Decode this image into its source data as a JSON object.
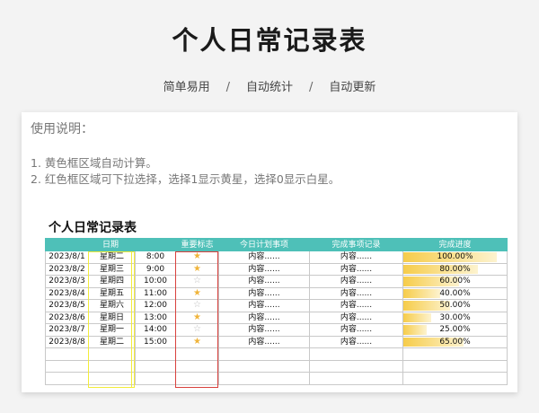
{
  "header": {
    "title": "个人日常记录表",
    "subtitle": [
      "简单易用",
      "自动统计",
      "自动更新"
    ],
    "separator": "/"
  },
  "instructions": {
    "title": "使用说明：",
    "lines": [
      "1. 黄色框区域自动计算。",
      "2. 红色框区域可下拉选择，选择1显示黄星，选择0显示白星。"
    ]
  },
  "sheet": {
    "title": "个人日常记录表",
    "columns": [
      "日期",
      "重要标志",
      "今日计划事项",
      "完成事项记录",
      "完成进度"
    ],
    "rows": [
      {
        "date": "2023/8/1",
        "weekday": "星期二",
        "time": "8:00",
        "star": "filled",
        "plan": "内容......",
        "done": "内容......",
        "progress": 1.0,
        "progress_label": "100.00%"
      },
      {
        "date": "2023/8/2",
        "weekday": "星期三",
        "time": "9:00",
        "star": "filled",
        "plan": "内容......",
        "done": "内容......",
        "progress": 0.8,
        "progress_label": "80.00%"
      },
      {
        "date": "2023/8/3",
        "weekday": "星期四",
        "time": "10:00",
        "star": "empty",
        "plan": "内容......",
        "done": "内容......",
        "progress": 0.6,
        "progress_label": "60.00%"
      },
      {
        "date": "2023/8/4",
        "weekday": "星期五",
        "time": "11:00",
        "star": "filled",
        "plan": "内容......",
        "done": "内容......",
        "progress": 0.4,
        "progress_label": "40.00%"
      },
      {
        "date": "2023/8/5",
        "weekday": "星期六",
        "time": "12:00",
        "star": "empty",
        "plan": "内容......",
        "done": "内容......",
        "progress": 0.5,
        "progress_label": "50.00%"
      },
      {
        "date": "2023/8/6",
        "weekday": "星期日",
        "time": "13:00",
        "star": "filled",
        "plan": "内容......",
        "done": "内容......",
        "progress": 0.3,
        "progress_label": "30.00%"
      },
      {
        "date": "2023/8/7",
        "weekday": "星期一",
        "time": "14:00",
        "star": "empty",
        "plan": "内容......",
        "done": "内容......",
        "progress": 0.25,
        "progress_label": "25.00%"
      },
      {
        "date": "2023/8/8",
        "weekday": "星期二",
        "time": "15:00",
        "star": "filled",
        "plan": "内容......",
        "done": "内容......",
        "progress": 0.65,
        "progress_label": "65.00%"
      }
    ],
    "empty_rows": 3,
    "icons": {
      "filled": "star-filled-icon",
      "empty": "star-empty-icon"
    },
    "colors": {
      "header": "#4ec0b8",
      "auto_box": "#f3ec3a",
      "dropdown_box": "#d9413d",
      "star": "#f0b43a",
      "bar": "#f6cc4a"
    }
  }
}
